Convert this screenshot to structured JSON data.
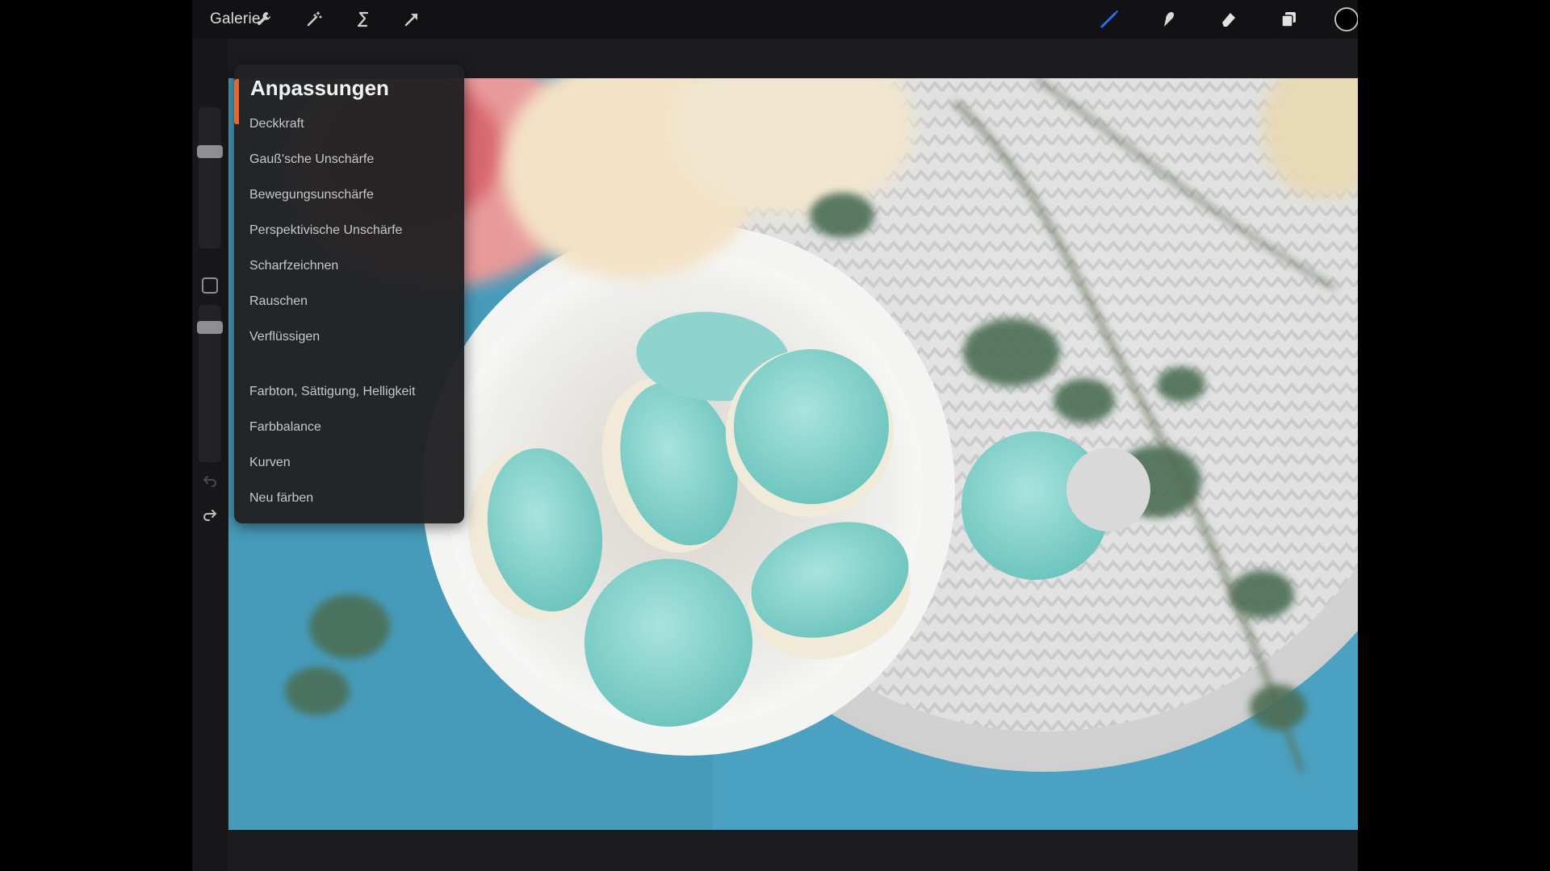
{
  "toolbar": {
    "gallery_label": "Galerie",
    "left_tools": [
      "wrench-icon",
      "magic-wand-icon",
      "selection-icon",
      "transform-arrow-icon"
    ],
    "right_tools": [
      "brush-icon",
      "smudge-icon",
      "eraser-icon",
      "layers-icon",
      "color-swatch"
    ],
    "accent_color": "#2f6bff",
    "current_color": "#000000"
  },
  "adjustments": {
    "title": "Anpassungen",
    "group1": [
      "Deckkraft",
      "Gauß'sche Unschärfe",
      "Bewegungsunschärfe",
      "Perspektivische Unschärfe",
      "Scharfzeichnen",
      "Rauschen",
      "Verflüssigen"
    ],
    "group2": [
      "Farbton, Sättigung, Helligkeit",
      "Farbbalance",
      "Kurven",
      "Neu färben"
    ],
    "accent": "#e06a2f"
  },
  "canvas": {
    "subject": "macarons-photo"
  }
}
